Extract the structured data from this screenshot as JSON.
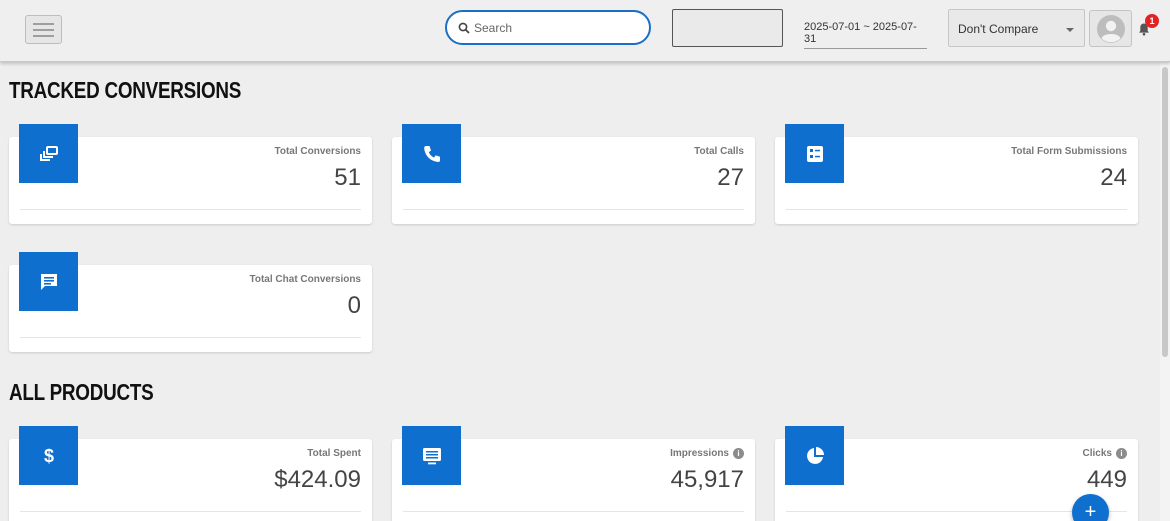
{
  "header": {
    "search_placeholder": "Search",
    "date_range": "2025-07-01 ~ 2025-07-31",
    "compare_selected": "Don't Compare",
    "notification_count": "1"
  },
  "sections": {
    "tracked": {
      "title": "TRACKED CONVERSIONS",
      "cards": [
        {
          "label": "Total Conversions",
          "value": "51",
          "icon": "conversions-icon"
        },
        {
          "label": "Total Calls",
          "value": "27",
          "icon": "phone-icon"
        },
        {
          "label": "Total Form Submissions",
          "value": "24",
          "icon": "form-icon"
        },
        {
          "label": "Total Chat Conversions",
          "value": "0",
          "icon": "chat-icon"
        }
      ]
    },
    "products": {
      "title": "ALL PRODUCTS",
      "cards": [
        {
          "label": "Total Spent",
          "value": "$424.09",
          "icon": "dollar-icon"
        },
        {
          "label": "Impressions",
          "value": "45,917",
          "icon": "monitor-icon"
        },
        {
          "label": "Clicks",
          "value": "449",
          "icon": "pie-chart-icon"
        }
      ]
    }
  },
  "fab_label": "+",
  "info_glyph": "i",
  "colors": {
    "accent": "#0f6fcf",
    "badge": "#e02424"
  }
}
